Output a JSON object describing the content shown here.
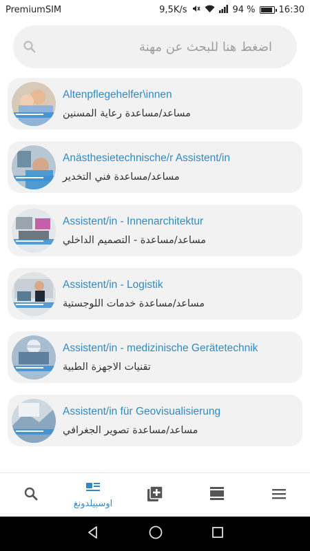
{
  "status_bar": {
    "carrier": "PremiumSIM",
    "speed": "9,5K/s",
    "battery": "94 %",
    "battery_level": 0.94,
    "time": "16:30"
  },
  "search": {
    "placeholder": "اضغط هنا للبحث عن مهنة"
  },
  "jobs": [
    {
      "title": "Altenpflegehelfer\\innen",
      "subtitle": "مساعد/مساعدة رعاية المسنين"
    },
    {
      "title": "Anästhesietechnische/r Assistent/in",
      "subtitle": "مساعد/مساعدة  فني التخدير"
    },
    {
      "title": "Assistent/in - Innenarchitektur",
      "subtitle": "مساعد/مساعدة - التصميم الداخلي"
    },
    {
      "title": "Assistent/in - Logistik",
      "subtitle": "مساعد/مساعدة خدمات اللوجستية"
    },
    {
      "title": "Assistent/in - medizinische Gerätetechnik",
      "subtitle": "تقنيات الاجهزة الطبية"
    },
    {
      "title": "Assistent/in für Geovisualisierung",
      "subtitle": "مساعد/مساعدة تصوير الجغرافي"
    }
  ],
  "bottom_nav": {
    "active_label": "اوسبيلدونغ",
    "accent": "#2e8ac4",
    "inactive": "#555555"
  }
}
